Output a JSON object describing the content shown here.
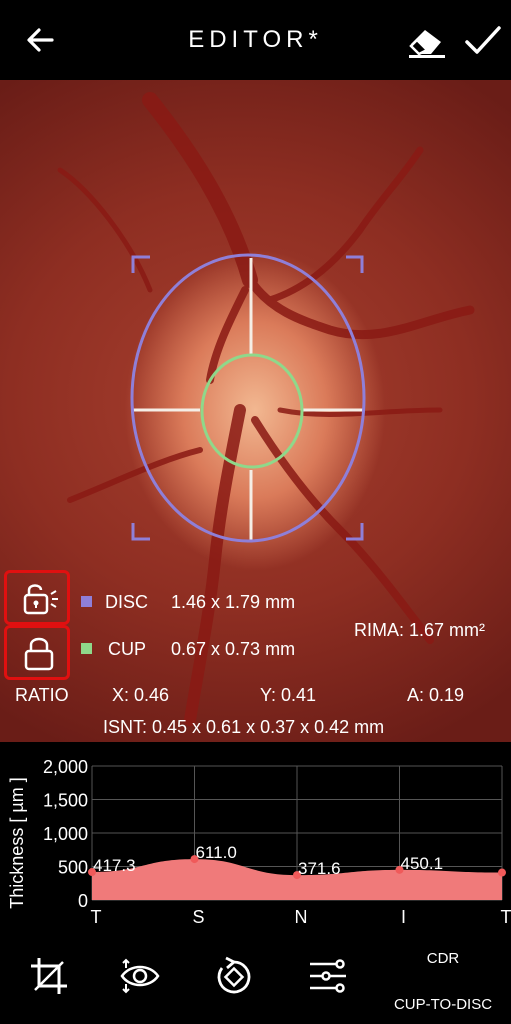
{
  "header": {
    "title": "EDITOR*",
    "back_icon": "arrow-left-icon",
    "eraser_icon": "eraser-icon",
    "confirm_icon": "check-icon"
  },
  "colors": {
    "disc": "#8f7fd8",
    "cup": "#8fd88a",
    "chart_fill": "#f07a7a",
    "lock_border": "#e01010"
  },
  "legend": {
    "disc_label": "DISC",
    "disc_value": "1.46 x 1.79 mm",
    "cup_label": "CUP",
    "cup_value": "0.67 x 0.73 mm",
    "rima": "RIMA: 1.67 mm²",
    "ratio_label": "RATIO",
    "x": "X: 0.46",
    "y": "Y: 0.41",
    "a": "A: 0.19",
    "isnt": "ISNT: 0.45 x 0.61 x 0.37 x 0.42 mm"
  },
  "chart_data": {
    "type": "area",
    "ylabel": "Thickness [ µm ]",
    "ylim": [
      0,
      2000
    ],
    "yticks": [
      "2,000",
      "1,500",
      "1,000",
      "500",
      "0"
    ],
    "xticks": [
      "T",
      "S",
      "N",
      "I",
      "T"
    ],
    "x": [
      0,
      1,
      2,
      3,
      4
    ],
    "values": [
      417.3,
      611.0,
      371.6,
      450.1,
      410
    ],
    "labels": [
      "417.3",
      "611.0",
      "371.6",
      "450.1"
    ]
  },
  "toolbar": {
    "tools": [
      "crop-icon",
      "eye-adjust-icon",
      "rotate-icon",
      "sliders-icon"
    ],
    "cdr": "CDR",
    "cdr_sub": "CUP-TO-DISC"
  }
}
